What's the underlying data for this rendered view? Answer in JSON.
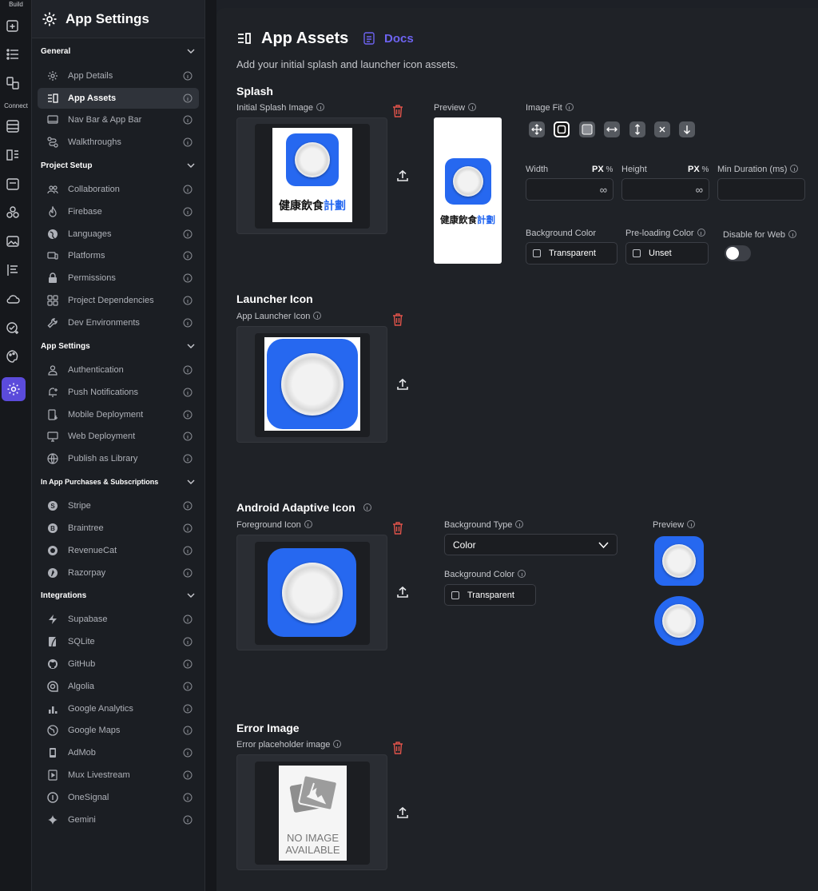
{
  "rail": {
    "build_label": "Build",
    "connect_label": "Connect"
  },
  "sidebar": {
    "title": "App Settings",
    "groups": {
      "general": "General",
      "project_setup": "Project Setup",
      "app_settings": "App Settings",
      "iap": "In App Purchases & Subscriptions",
      "integrations": "Integrations"
    },
    "items": {
      "app_details": "App Details",
      "app_assets": "App Assets",
      "nav_bar": "Nav Bar & App Bar",
      "walkthroughs": "Walkthroughs",
      "collaboration": "Collaboration",
      "firebase": "Firebase",
      "languages": "Languages",
      "platforms": "Platforms",
      "permissions": "Permissions",
      "project_dependencies": "Project Dependencies",
      "dev_environments": "Dev Environments",
      "authentication": "Authentication",
      "push_notifications": "Push Notifications",
      "mobile_deployment": "Mobile Deployment",
      "web_deployment": "Web Deployment",
      "publish_library": "Publish as Library",
      "stripe": "Stripe",
      "braintree": "Braintree",
      "revenuecat": "RevenueCat",
      "razorpay": "Razorpay",
      "supabase": "Supabase",
      "sqlite": "SQLite",
      "github": "GitHub",
      "algolia": "Algolia",
      "google_analytics": "Google Analytics",
      "google_maps": "Google Maps",
      "admob": "AdMob",
      "mux": "Mux Livestream",
      "onesignal": "OneSignal",
      "gemini": "Gemini"
    }
  },
  "main": {
    "title": "App Assets",
    "docs_label": "Docs",
    "subtitle": "Add your initial splash and launcher icon assets.",
    "splash": {
      "heading": "Splash",
      "initial_label": "Initial Splash Image",
      "preview_label": "Preview",
      "image_fit_label": "Image Fit",
      "width_label": "Width",
      "height_label": "Height",
      "unit_px": "PX",
      "unit_pct": "%",
      "width_value": "∞",
      "height_value": "∞",
      "min_duration_label": "Min Duration (ms)",
      "bg_color_label": "Background Color",
      "bg_color_value": "Transparent",
      "preloading_label": "Pre-loading Color",
      "preloading_value": "Unset",
      "disable_web_label": "Disable for Web",
      "splash_text_black": "健康飲食",
      "splash_text_blue": "計劃"
    },
    "launcher": {
      "heading": "Launcher Icon",
      "label": "App Launcher Icon"
    },
    "adaptive": {
      "heading": "Android Adaptive Icon",
      "foreground_label": "Foreground Icon",
      "bg_type_label": "Background Type",
      "bg_type_value": "Color",
      "bg_color_label": "Background Color",
      "bg_color_value": "Transparent",
      "preview_label": "Preview"
    },
    "error": {
      "heading": "Error Image",
      "label": "Error placeholder image",
      "placeholder_line1": "NO IMAGE",
      "placeholder_line2": "AVAILABLE"
    }
  },
  "colors": {
    "accent": "#5b4bdb",
    "app_blue": "#2668f0",
    "delete_red": "#e0534a"
  }
}
